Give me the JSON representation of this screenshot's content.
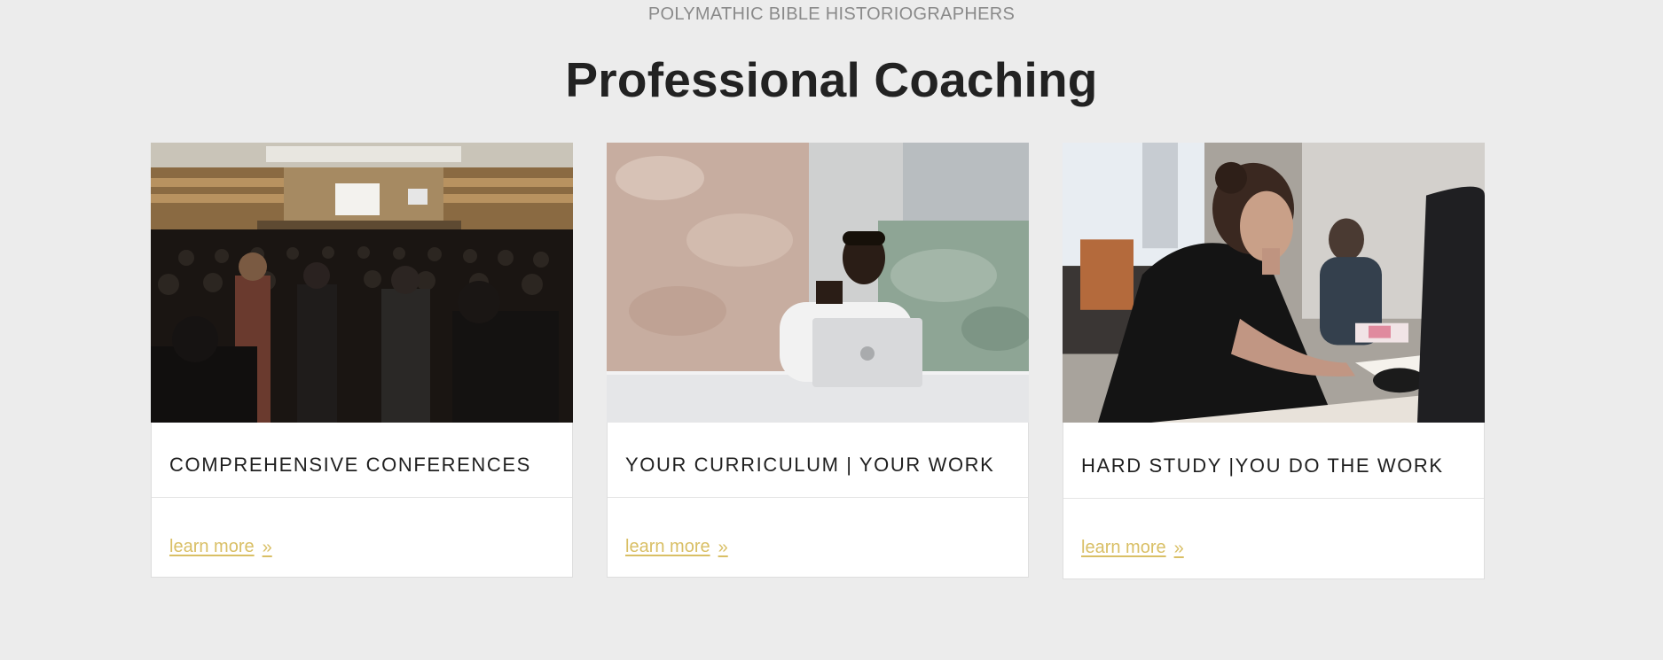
{
  "header": {
    "eyebrow": "POLYMATHIC BIBLE HISTORIOGRAPHERS",
    "title": "Professional Coaching"
  },
  "cards": [
    {
      "title": "COMPREHENSIVE CONFERENCES",
      "link_label": "learn more",
      "link_icon": "double-chevron-right-icon",
      "image": "conference-hall-photo"
    },
    {
      "title": "YOUR CURRICULUM | YOUR WORK",
      "link_label": "learn more",
      "link_icon": "double-chevron-right-icon",
      "image": "man-with-laptop-photo"
    },
    {
      "title": "HARD STUDY |YOU DO THE WORK",
      "link_label": "learn more",
      "link_icon": "double-chevron-right-icon",
      "image": "woman-studying-photo"
    }
  ],
  "colors": {
    "background": "#ececec",
    "link": "#d9bf65",
    "title": "#222222"
  }
}
